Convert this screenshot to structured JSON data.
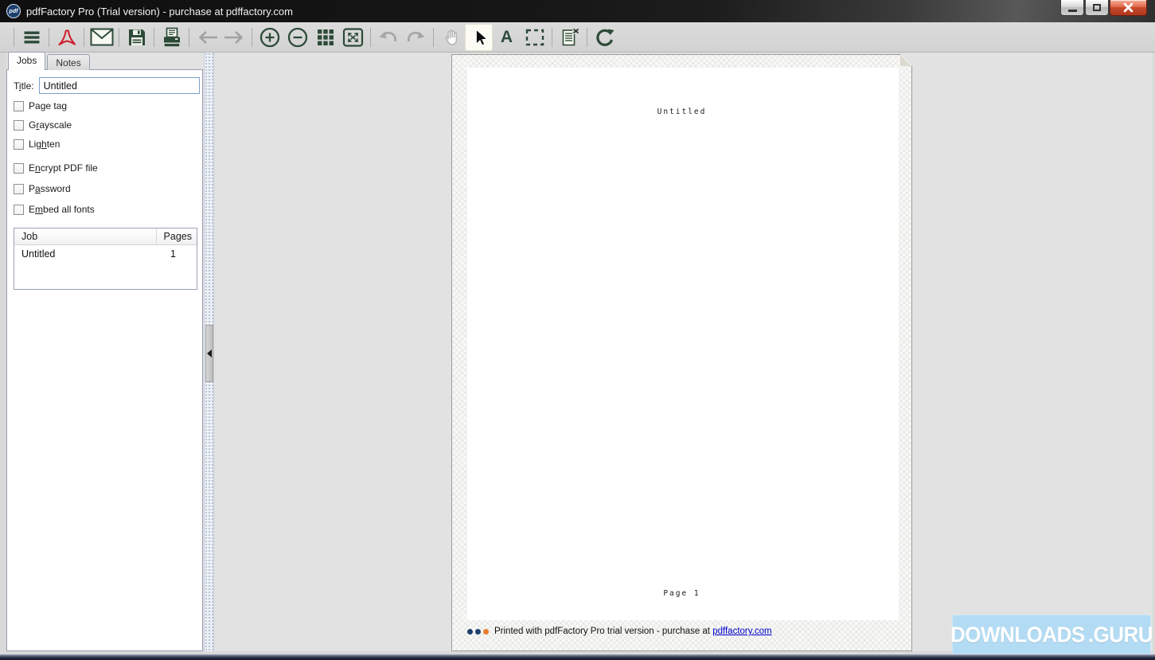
{
  "window": {
    "title": "pdfFactory Pro (Trial version) - purchase at pdffactory.com",
    "logo_text": "pdf"
  },
  "toolbar": {
    "text_tool_glyph": "A",
    "active_tool": "select-cursor",
    "icons": [
      "menu",
      "acrobat-pdf",
      "email",
      "save",
      "print",
      "back",
      "forward",
      "zoom-in",
      "zoom-out",
      "thumbnail-grid",
      "fit-page",
      "undo",
      "redo",
      "hand",
      "select-cursor",
      "text-tool",
      "marquee-select",
      "delete-job",
      "refresh"
    ]
  },
  "panel": {
    "tabs": [
      {
        "label": "Jobs",
        "active": true
      },
      {
        "label": "Notes",
        "active": false
      }
    ],
    "title_field": {
      "label_pre": "T",
      "label_mnemonic": "i",
      "label_post": "tle:",
      "value": "Untitled"
    },
    "checkboxes": [
      {
        "pre": "Pa",
        "mnemonic": "g",
        "post": "e tag",
        "checked": false
      },
      {
        "pre": "G",
        "mnemonic": "r",
        "post": "ayscale",
        "checked": false
      },
      {
        "pre": "Lig",
        "mnemonic": "h",
        "post": "ten",
        "checked": false
      },
      {
        "pre": "E",
        "mnemonic": "n",
        "post": "crypt PDF file",
        "checked": false
      },
      {
        "pre": "P",
        "mnemonic": "a",
        "post": "ssword",
        "checked": false
      },
      {
        "pre": "E",
        "mnemonic": "m",
        "post": "bed all fonts",
        "checked": false
      }
    ],
    "jobs_table": {
      "columns": [
        "Job",
        "Pages"
      ],
      "rows": [
        {
          "job": "Untitled",
          "pages": "1"
        }
      ]
    }
  },
  "preview": {
    "doc_header": "Untitled",
    "page_footer": "Page 1",
    "trial_notice": {
      "prefix": "Printed with pdfFactory Pro trial version - purchase at ",
      "link": "pdffactory.com"
    }
  },
  "watermark": {
    "left": "DOWNLOADS",
    "right": ".GURU"
  },
  "colors": {
    "icon_green": "#2d4a38",
    "acrobat_red": "#d0202e",
    "close_button_red": "#c64a2c",
    "watermark_bg": "#b3dcf4",
    "link_blue": "#0000cc",
    "dot_navy": "#1c3f6e",
    "dot_orange": "#e87d2a"
  }
}
